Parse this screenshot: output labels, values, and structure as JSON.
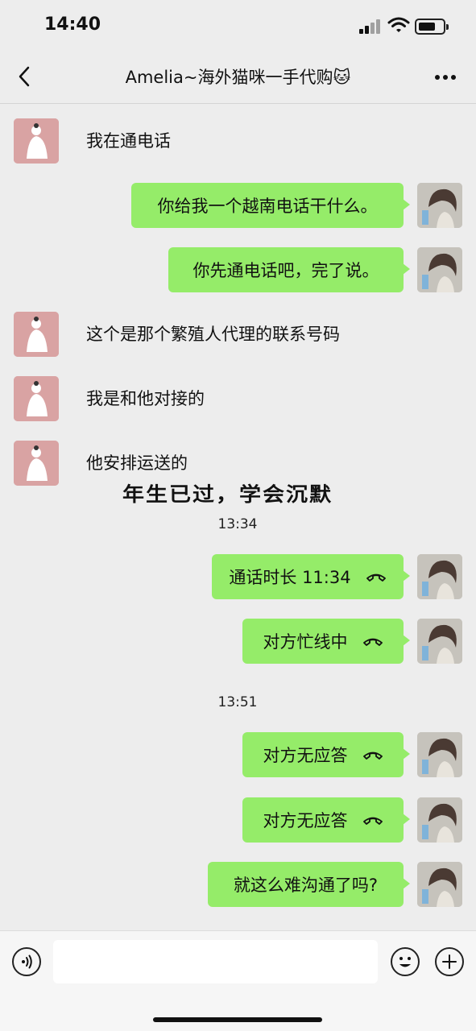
{
  "status_bar": {
    "time": "14:40"
  },
  "nav": {
    "title": "Amelia~海外猫咪一手代购🐱"
  },
  "messages": [
    {
      "type": "text",
      "side": "left",
      "text": "我在通电话"
    },
    {
      "type": "text",
      "side": "right",
      "text": "你给我一个越南电话干什么。"
    },
    {
      "type": "text",
      "side": "right",
      "text": "你先通电话吧，完了说。"
    },
    {
      "type": "text",
      "side": "left",
      "text": "这个是那个繁殖人代理的联系号码"
    },
    {
      "type": "text",
      "side": "left",
      "text": "我是和他对接的"
    },
    {
      "type": "text",
      "side": "left",
      "text": "他安排运送的"
    },
    {
      "type": "timestamp",
      "text": "13:34"
    },
    {
      "type": "call",
      "side": "right",
      "text": "通话时长 11:34"
    },
    {
      "type": "call",
      "side": "right",
      "text": "对方忙线中"
    },
    {
      "type": "timestamp",
      "text": "13:51"
    },
    {
      "type": "call",
      "side": "right",
      "text": "对方无应答"
    },
    {
      "type": "call",
      "side": "right",
      "text": "对方无应答"
    },
    {
      "type": "text",
      "side": "right",
      "text": "就这么难沟通了吗?"
    }
  ],
  "overlay_caption": "年生已过，学会沉默",
  "input_bar": {
    "placeholder": ""
  },
  "colors": {
    "background": "#ededed",
    "outgoing_bubble": "#95ec69",
    "left_avatar": "#d9a3a3"
  },
  "icons": [
    "back-icon",
    "more-icon",
    "voice-icon",
    "emoji-icon",
    "plus-icon",
    "phone-hangup-icon",
    "signal-icon",
    "wifi-icon",
    "battery-icon"
  ]
}
